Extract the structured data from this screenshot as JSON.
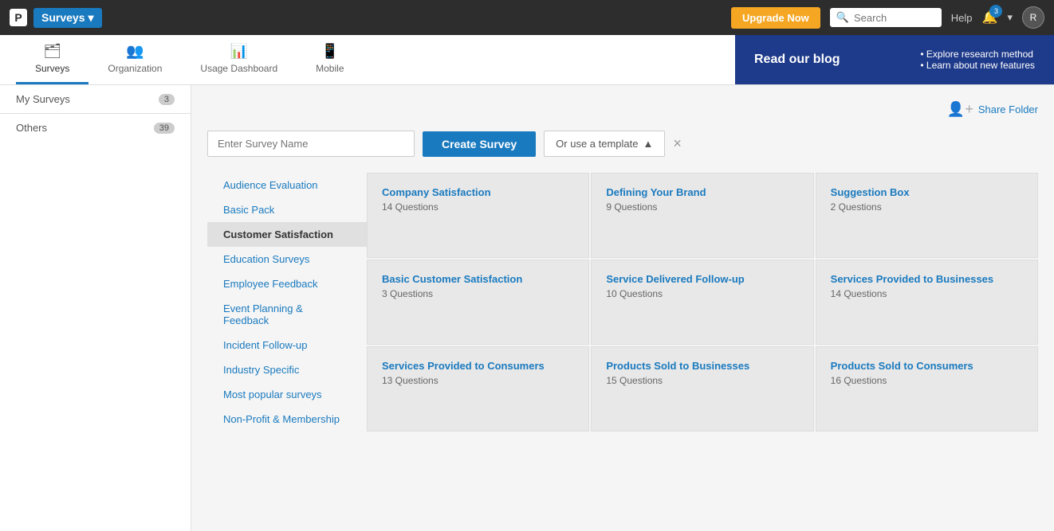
{
  "topNav": {
    "logoLetter": "P",
    "appName": "Surveys",
    "upgradeLabel": "Upgrade Now",
    "searchPlaceholder": "Search",
    "helpLabel": "Help",
    "notificationCount": "3",
    "avatarLabel": "R"
  },
  "subNav": {
    "tabs": [
      {
        "id": "surveys",
        "label": "Surveys",
        "icon": "🗂",
        "active": true
      },
      {
        "id": "organization",
        "label": "Organization",
        "icon": "👥",
        "active": false
      },
      {
        "id": "usage",
        "label": "Usage Dashboard",
        "icon": "📊",
        "active": false
      },
      {
        "id": "mobile",
        "label": "Mobile",
        "icon": "📱",
        "active": false
      }
    ],
    "blog": {
      "title": "Read our blog",
      "bullets": [
        "Explore research method",
        "Learn about new features"
      ]
    }
  },
  "sidebar": {
    "items": [
      {
        "id": "my-surveys",
        "label": "My Surveys",
        "count": "3",
        "active": false
      },
      {
        "id": "others",
        "label": "Others",
        "count": "39",
        "active": false
      }
    ]
  },
  "contentHeader": {
    "shareFolder": "Share Folder"
  },
  "createRow": {
    "inputPlaceholder": "Enter Survey Name",
    "createBtn": "Create Survey",
    "templateBtn": "Or use a template",
    "closeBtn": "×"
  },
  "categories": [
    {
      "id": "audience",
      "label": "Audience Evaluation",
      "selected": false
    },
    {
      "id": "basic-pack",
      "label": "Basic Pack",
      "selected": false
    },
    {
      "id": "customer",
      "label": "Customer Satisfaction",
      "selected": true
    },
    {
      "id": "education",
      "label": "Education Surveys",
      "selected": false
    },
    {
      "id": "employee",
      "label": "Employee Feedback",
      "selected": false
    },
    {
      "id": "event",
      "label": "Event Planning & Feedback",
      "selected": false
    },
    {
      "id": "incident",
      "label": "Incident Follow-up",
      "selected": false
    },
    {
      "id": "industry",
      "label": "Industry Specific",
      "selected": false
    },
    {
      "id": "popular",
      "label": "Most popular surveys",
      "selected": false
    },
    {
      "id": "nonprofit",
      "label": "Non-Profit & Membership",
      "selected": false
    }
  ],
  "templateCards": [
    {
      "id": "company-satisfaction",
      "title": "Company Satisfaction",
      "sub": "14 Questions"
    },
    {
      "id": "defining-brand",
      "title": "Defining Your Brand",
      "sub": "9 Questions"
    },
    {
      "id": "suggestion-box",
      "title": "Suggestion Box",
      "sub": "2 Questions"
    },
    {
      "id": "basic-customer",
      "title": "Basic Customer Satisfaction",
      "sub": "3 Questions"
    },
    {
      "id": "service-delivered",
      "title": "Service Delivered Follow-up",
      "sub": "10 Questions"
    },
    {
      "id": "services-businesses",
      "title": "Services Provided to Businesses",
      "sub": "14 Questions"
    },
    {
      "id": "services-consumers",
      "title": "Services Provided to Consumers",
      "sub": "13 Questions"
    },
    {
      "id": "products-businesses",
      "title": "Products Sold to Businesses",
      "sub": "15 Questions"
    },
    {
      "id": "products-consumers",
      "title": "Products Sold to Consumers",
      "sub": "16 Questions"
    }
  ]
}
